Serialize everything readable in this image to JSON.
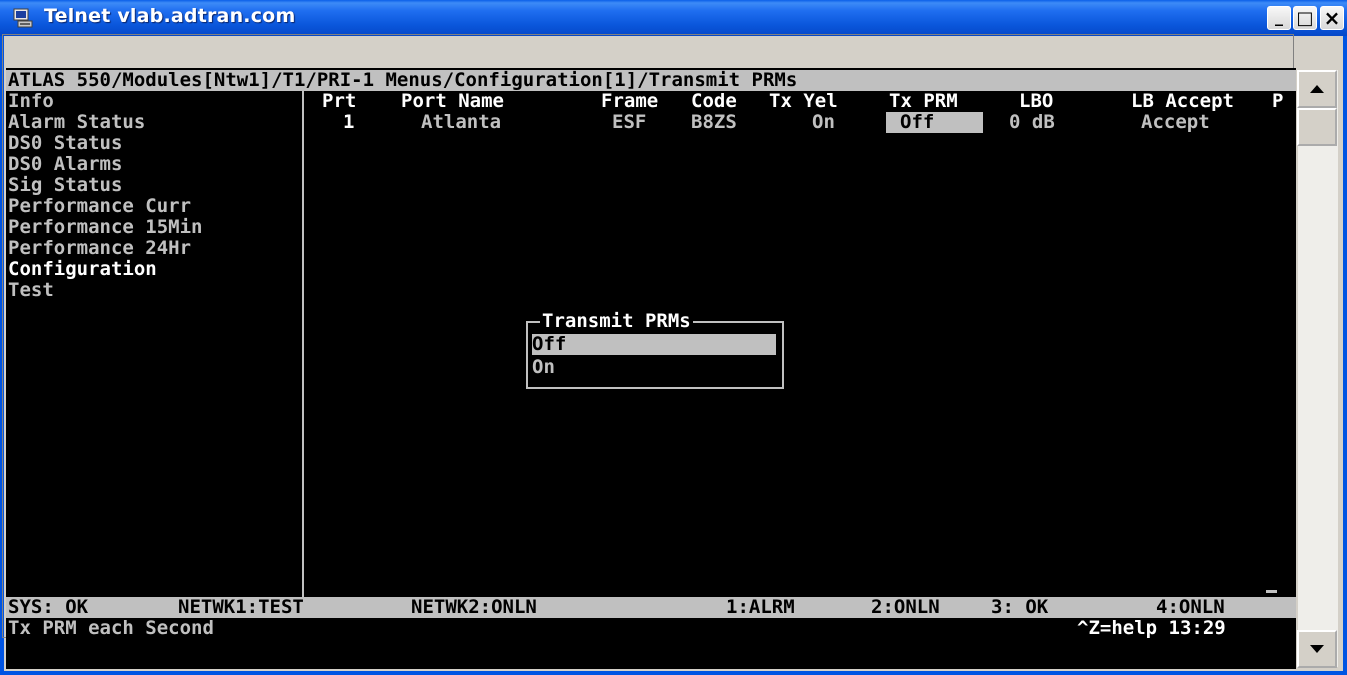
{
  "window": {
    "title": "Telnet vlab.adtran.com",
    "minimize_label": "_",
    "maximize_label": "□",
    "close_label": "×"
  },
  "terminal": {
    "header_path": "ATLAS 550/Modules[Ntw1]/T1/PRI-1 Menus/Configuration[1]/Transmit PRMs",
    "menu_items": [
      "Info",
      "Alarm Status",
      "DS0 Status",
      "DS0 Alarms",
      "Sig Status",
      "Performance Curr",
      "Performance 15Min",
      "Performance 24Hr",
      "Configuration",
      "Test"
    ],
    "selected_menu_item": "Configuration",
    "table": {
      "columns": [
        "Prt",
        "Port Name",
        "Frame",
        "Code",
        "Tx Yel",
        "Tx PRM",
        "LBO",
        "LB Accept",
        "P"
      ],
      "row": {
        "prt": "1",
        "port_name": "Atlanta",
        "frame": "ESF",
        "code": "B8ZS",
        "tx_yel": "On",
        "tx_prm": "Off",
        "lbo": "0 dB",
        "lb_accept": "Accept"
      }
    },
    "popup": {
      "title": "Transmit PRMs",
      "options": [
        "Off",
        "On"
      ],
      "selected": "Off"
    },
    "status_bar": {
      "sys": "SYS: OK",
      "netwk1": "NETWK1:TEST",
      "netwk2": "NETWK2:ONLN",
      "slot1": "1:ALRM",
      "slot2": "2:ONLN",
      "slot3": "3: OK",
      "slot4": "4:ONLN"
    },
    "help_line": "Tx PRM each Second",
    "help_hint": "^Z=help 13:29"
  }
}
